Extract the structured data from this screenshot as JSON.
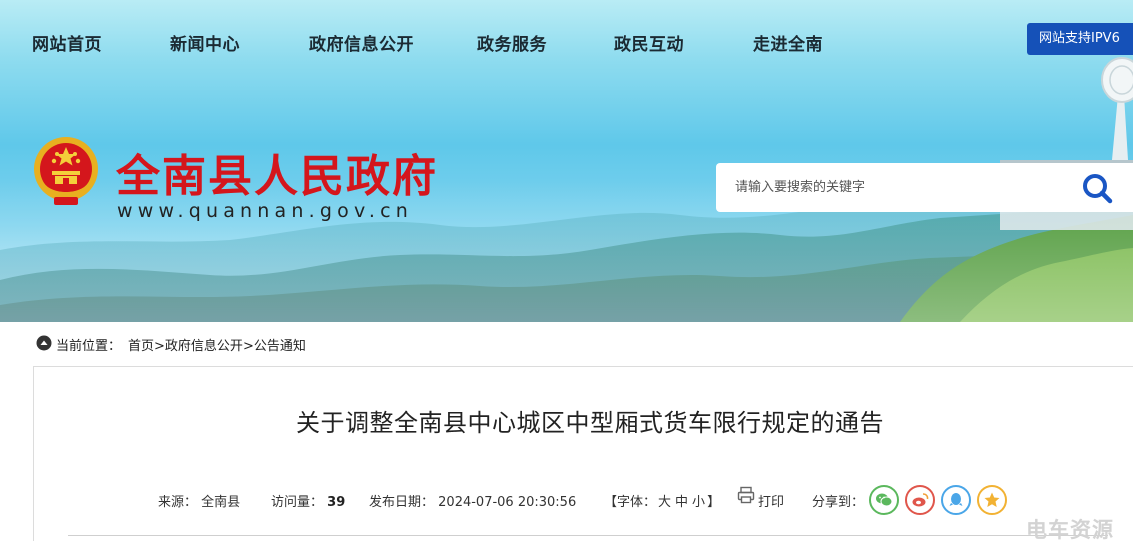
{
  "nav": {
    "items": [
      "网站首页",
      "新闻中心",
      "政府信息公开",
      "政务服务",
      "政民互动",
      "走进全南"
    ],
    "ipv6_label": "网站支持IPV6"
  },
  "site": {
    "title": "全南县人民政府",
    "domain": "www.quannan.gov.cn"
  },
  "search": {
    "placeholder": "请输入要搜索的关键字",
    "value": ""
  },
  "breadcrumb": {
    "label": "当前位置：",
    "items": [
      "首页",
      "政府信息公开",
      "公告通知"
    ],
    "separator": ">"
  },
  "article": {
    "title": "关于调整全南县中心城区中型厢式货车限行规定的通告",
    "source_label": "来源：",
    "source": "全南县",
    "views_label": "访问量：",
    "views": "39",
    "date_label": "发布日期：",
    "date": "2024-07-06 20:30:56",
    "font_label": "【字体：",
    "font_sizes": [
      "大",
      "中",
      "小"
    ],
    "font_close": "】",
    "print_label": "打印",
    "share_label": "分享到："
  },
  "share_icons": [
    "wechat-icon",
    "weibo-icon",
    "qq-icon",
    "qzone-icon"
  ],
  "colors": {
    "brand_red": "#d4161c",
    "nav_blue": "#1551b8",
    "wechat": "#5bb85d",
    "weibo": "#e0564b",
    "qq": "#4aa6e8",
    "qzone": "#f2b233"
  },
  "watermark": "电车资源"
}
